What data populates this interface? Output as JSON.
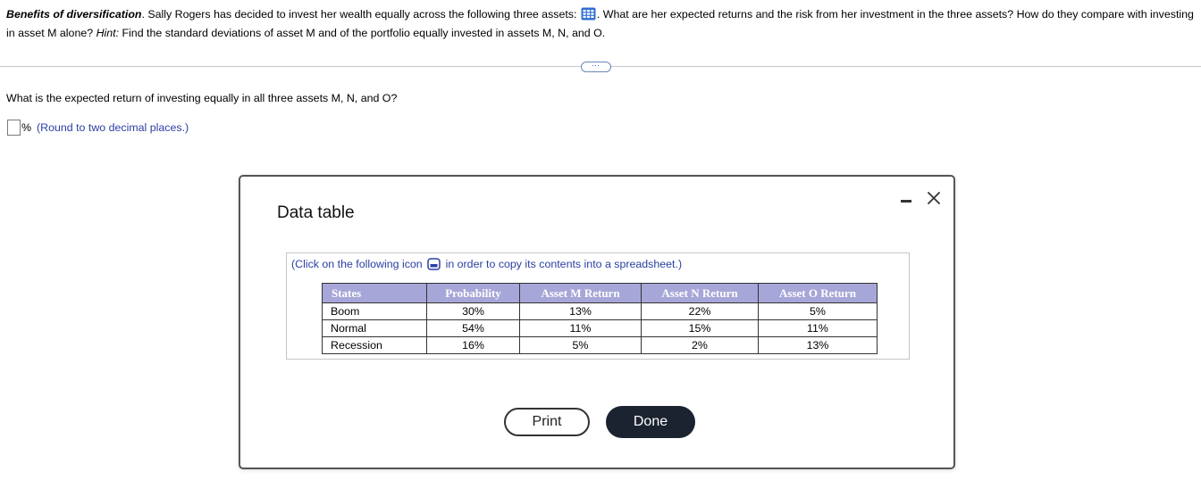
{
  "question": {
    "title": "Benefits of diversification",
    "title_suffix": ".",
    "text_before_icon": " Sally Rogers has decided to invest her wealth equally across the following three assets: ",
    "text_after_icon": ". What are her expected returns and the risk from her investment in the three assets? How do they compare with investing in asset M alone? ",
    "hint_label": "Hint:",
    "hint_text": " Find the standard deviations of asset M and of the portfolio equally invested in assets M, N, and O."
  },
  "expand_button_label": "⋯",
  "sub_question": "What is the expected return of investing equally in all three assets M, N, and O?",
  "answer": {
    "value": "",
    "unit": "%",
    "hint": "(Round to two decimal places.)"
  },
  "modal": {
    "title": "Data table",
    "note_before_icon": "(Click on the following icon ",
    "note_after_icon": " in order to copy its contents into a spreadsheet.)",
    "columns": [
      "States",
      "Probability",
      "Asset M Return",
      "Asset N Return",
      "Asset O Return"
    ],
    "rows": [
      [
        "Boom",
        "30%",
        "13%",
        "22%",
        "5%"
      ],
      [
        "Normal",
        "54%",
        "11%",
        "15%",
        "11%"
      ],
      [
        "Recession",
        "16%",
        "5%",
        "2%",
        "13%"
      ]
    ],
    "print_label": "Print",
    "done_label": "Done"
  },
  "colors": {
    "table_header_bg": "#a6a6d8",
    "link_blue": "#2a3fa3",
    "done_button_bg": "#1c2330"
  }
}
